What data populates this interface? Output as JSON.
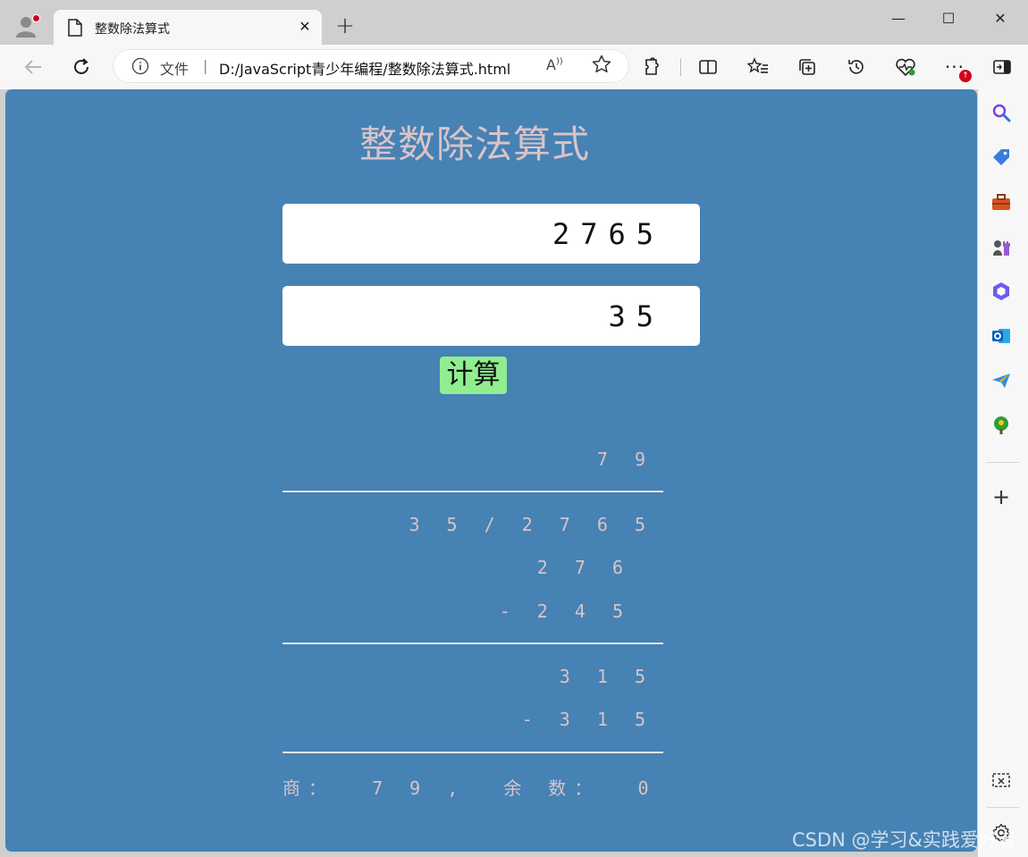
{
  "browser": {
    "tab": {
      "title": "整数除法算式"
    },
    "address": {
      "scheme_label": "文件",
      "separator": "|",
      "url": "D:/JavaScript青少年编程/整数除法算式.html"
    },
    "window_controls": {
      "minimize": "—",
      "maximize": "☐",
      "close": "✕"
    },
    "new_tab": "+"
  },
  "page": {
    "title": "整数除法算式",
    "dividend_value": "2765",
    "divisor_value": "35",
    "calc_button": "计算",
    "long_division": {
      "quotient_row": "7 9",
      "divisor_dividend_row": "3 5 / 2 7 6 5",
      "step1_partial": "2 7 6",
      "step1_subtract": "- 2 4 5",
      "step2_partial": "3 1 5",
      "step2_subtract": "- 3 1 5",
      "result_row": "商：  7 9 ,  余 数：  0"
    }
  },
  "watermark": "CSDN @学习&实践爱好者",
  "colors": {
    "page_bg": "#4682b4",
    "title_text": "#d9c3c8",
    "button_bg": "#90ee90",
    "chrome_bg": "#cfcfcf",
    "toolbar_bg": "#f7f7f7"
  },
  "icons": {
    "sidebar": [
      "search-icon",
      "tag-icon",
      "toolbox-icon",
      "chess-icon",
      "office-icon",
      "outlook-icon",
      "send-icon",
      "tree-icon",
      "add-icon",
      "screenshot-icon",
      "settings-icon"
    ]
  }
}
